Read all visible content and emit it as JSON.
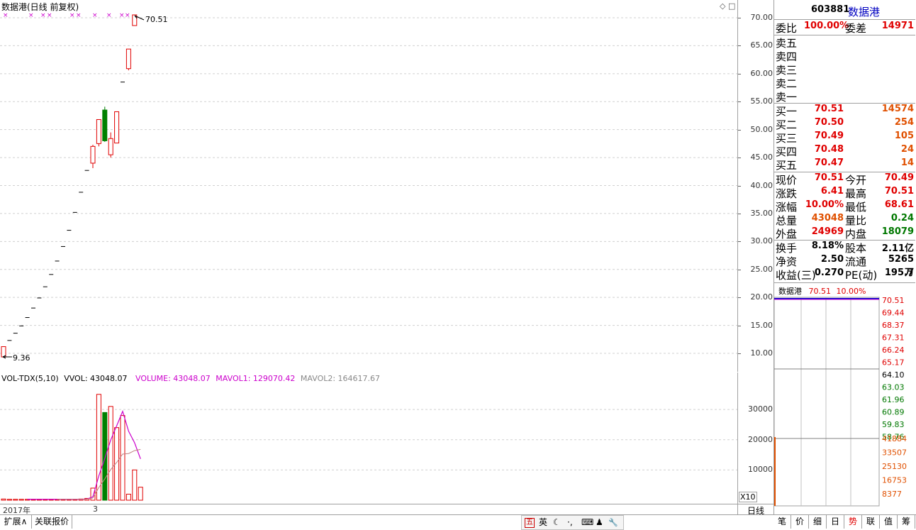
{
  "main_chart": {
    "title": "数据港(日线 前复权)",
    "high_label": "70.51",
    "low_label": "9.36",
    "y_ticks": [
      "70.00",
      "65.00",
      "60.00",
      "55.00",
      "50.00",
      "45.00",
      "40.00",
      "35.00",
      "30.00",
      "25.00",
      "20.00",
      "15.00",
      "10.00"
    ],
    "candles": [
      {
        "o": 9.36,
        "h": 11.2,
        "l": 9.36,
        "c": 11.2
      },
      {
        "o": 12.3,
        "h": 12.3,
        "l": 12.3,
        "c": 12.3
      },
      {
        "o": 13.6,
        "h": 13.6,
        "l": 13.6,
        "c": 13.6
      },
      {
        "o": 14.9,
        "h": 14.9,
        "l": 14.9,
        "c": 14.9
      },
      {
        "o": 16.4,
        "h": 16.4,
        "l": 16.4,
        "c": 16.4
      },
      {
        "o": 18.1,
        "h": 18.1,
        "l": 18.1,
        "c": 18.1
      },
      {
        "o": 19.9,
        "h": 19.9,
        "l": 19.9,
        "c": 19.9
      },
      {
        "o": 21.9,
        "h": 21.9,
        "l": 21.9,
        "c": 21.9
      },
      {
        "o": 24.1,
        "h": 24.1,
        "l": 24.1,
        "c": 24.1
      },
      {
        "o": 26.5,
        "h": 26.5,
        "l": 26.5,
        "c": 26.5
      },
      {
        "o": 29.1,
        "h": 29.1,
        "l": 29.1,
        "c": 29.1
      },
      {
        "o": 32.0,
        "h": 32.0,
        "l": 32.0,
        "c": 32.0
      },
      {
        "o": 35.2,
        "h": 35.2,
        "l": 35.2,
        "c": 35.2
      },
      {
        "o": 38.8,
        "h": 38.8,
        "l": 38.8,
        "c": 38.8
      },
      {
        "o": 42.7,
        "h": 42.7,
        "l": 42.7,
        "c": 42.7
      },
      {
        "o": 44.0,
        "h": 47.3,
        "l": 43.1,
        "c": 47.0
      },
      {
        "o": 47.5,
        "h": 51.8,
        "l": 47.0,
        "c": 51.8
      },
      {
        "o": 53.5,
        "h": 54.1,
        "l": 47.8,
        "c": 48.0
      },
      {
        "o": 45.5,
        "h": 49.5,
        "l": 45.0,
        "c": 48.4
      },
      {
        "o": 47.6,
        "h": 53.2,
        "l": 47.6,
        "c": 53.2
      },
      {
        "o": 58.5,
        "h": 58.5,
        "l": 58.5,
        "c": 58.5
      },
      {
        "o": 60.9,
        "h": 64.4,
        "l": 60.6,
        "c": 64.4
      },
      {
        "o": 68.6,
        "h": 70.51,
        "l": 68.61,
        "c": 70.51
      }
    ]
  },
  "vol_chart": {
    "label_name": "VOL-TDX(5,10)",
    "label_vvol": "VVOL: 43048.07",
    "label_volume": "VOLUME: 43048.07",
    "label_mavol1": "MAVOL1: 129070.42",
    "label_mavol2": "MAVOL2: 164617.67",
    "y_ticks": [
      "30000",
      "20000",
      "10000"
    ],
    "unit": "X10",
    "date_left": "2017年",
    "date_mid": "3",
    "volumes": [
      400,
      300,
      300,
      300,
      300,
      300,
      300,
      300,
      300,
      300,
      300,
      300,
      300,
      400,
      600,
      4000,
      35000,
      29000,
      31000,
      24000,
      28000,
      2000,
      10000,
      4300
    ]
  },
  "period_label": "日线",
  "stock": {
    "code": "603881",
    "name": "数据港"
  },
  "quote": {
    "weibi_label": "委比",
    "weibi": "100.00%",
    "weicha_label": "委差",
    "weicha": "14971",
    "sells": [
      {
        "label": "卖五"
      },
      {
        "label": "卖四"
      },
      {
        "label": "卖三"
      },
      {
        "label": "卖二"
      },
      {
        "label": "卖一"
      }
    ],
    "buys": [
      {
        "label": "买一",
        "price": "70.51",
        "vol": "14574"
      },
      {
        "label": "买二",
        "price": "70.50",
        "vol": "254"
      },
      {
        "label": "买三",
        "price": "70.49",
        "vol": "105"
      },
      {
        "label": "买四",
        "price": "70.48",
        "vol": "24"
      },
      {
        "label": "买五",
        "price": "70.47",
        "vol": "14"
      }
    ],
    "stats": [
      {
        "l1": "现价",
        "v1": "70.51",
        "c1": "red",
        "l2": "今开",
        "v2": "70.49",
        "c2": "red"
      },
      {
        "l1": "涨跌",
        "v1": "6.41",
        "c1": "red",
        "l2": "最高",
        "v2": "70.51",
        "c2": "red"
      },
      {
        "l1": "涨幅",
        "v1": "10.00%",
        "c1": "red",
        "l2": "最低",
        "v2": "68.61",
        "c2": "red"
      },
      {
        "l1": "总量",
        "v1": "43048",
        "c1": "orange",
        "l2": "量比",
        "v2": "0.24",
        "c2": "green"
      },
      {
        "l1": "外盘",
        "v1": "24969",
        "c1": "red",
        "l2": "内盘",
        "v2": "18079",
        "c2": "green"
      }
    ],
    "fund": [
      {
        "l1": "换手",
        "v1": "8.18%",
        "l2": "股本",
        "v2": "2.11亿"
      },
      {
        "l1": "净资",
        "v1": "2.50",
        "l2": "流通",
        "v2": "5265万"
      },
      {
        "l1": "收益(三)",
        "v1": "0.270",
        "l2": "PE(动)",
        "v2": "195.7"
      }
    ]
  },
  "mini_chart": {
    "header_name": "数据港",
    "header_price": "70.51",
    "header_pct": "10.00%",
    "price_ticks": [
      "70.51",
      "69.44",
      "68.37",
      "67.31",
      "66.24",
      "65.17",
      "64.10",
      "63.03",
      "61.96",
      "60.89",
      "59.83",
      "58.76"
    ],
    "vol_ticks": [
      "41884",
      "33507",
      "25130",
      "16753",
      "8377"
    ]
  },
  "bottom_tabs": [
    "扩展∧",
    "关联报价"
  ],
  "ime": {
    "items": [
      "五",
      "英",
      "☾",
      "·,",
      "⌨",
      "♟",
      "🔧"
    ]
  },
  "right_tabs": [
    "笔",
    "价",
    "细",
    "日",
    "势",
    "联",
    "值",
    "筹"
  ],
  "colors": {
    "up": "#e00000",
    "down": "#008000",
    "mavol1": "#cc00cc",
    "mavol2": "#c08080"
  }
}
